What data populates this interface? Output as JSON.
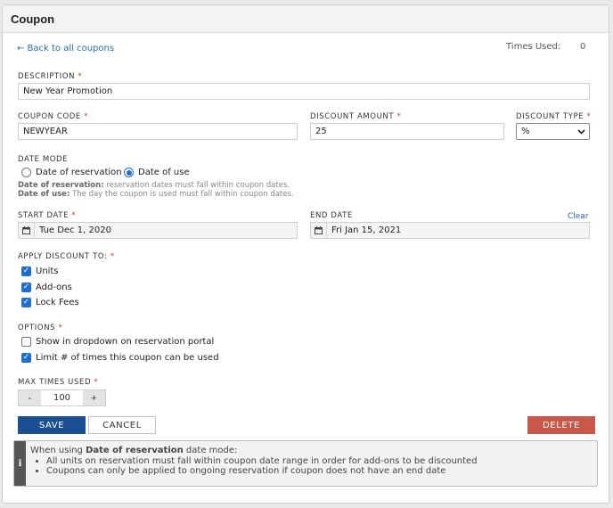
{
  "panel": {
    "title": "Coupon"
  },
  "nav": {
    "back_label": "← Back to all coupons",
    "times_used_label": "Times Used:",
    "times_used_value": "0"
  },
  "description": {
    "label": "DESCRIPTION",
    "value": "New Year Promotion"
  },
  "coupon_code": {
    "label": "COUPON CODE",
    "value": "NEWYEAR"
  },
  "discount_amount": {
    "label": "DISCOUNT AMOUNT",
    "value": "25"
  },
  "discount_type": {
    "label": "DISCOUNT TYPE",
    "value": "%"
  },
  "date_mode": {
    "label": "DATE MODE",
    "options": [
      "Date of reservation",
      "Date of use"
    ],
    "selected": "Date of use",
    "help_reservation_term": "Date of reservation:",
    "help_reservation_text": "reservation dates must fall within coupon dates.",
    "help_use_term": "Date of use:",
    "help_use_text": "The day the coupon is used must fall within coupon dates."
  },
  "start_date": {
    "label": "START DATE",
    "value": "Tue Dec 1, 2020"
  },
  "end_date": {
    "label": "END DATE",
    "value": "Fri Jan 15, 2021",
    "clear_label": "Clear"
  },
  "apply_to": {
    "label": "APPLY DISCOUNT TO:",
    "items": [
      "Units",
      "Add-ons",
      "Lock Fees"
    ]
  },
  "options": {
    "label": "OPTIONS",
    "items": [
      "Show in dropdown on reservation portal",
      "Limit # of times this coupon can be used"
    ]
  },
  "max_times": {
    "label": "MAX TIMES USED",
    "minus": "-",
    "value": "100",
    "plus": "+"
  },
  "actions": {
    "save": "SAVE",
    "cancel": "CANCEL",
    "delete": "DELETE"
  },
  "note": {
    "intro": "When using",
    "mode": "Date of reservation",
    "suffix": "date mode:",
    "bullets": [
      "All units on reservation must fall within coupon date range in order for add-ons to be discounted",
      "Coupons can only be applied to ongoing reservation if coupon does not have an end date"
    ]
  },
  "colors": {
    "primary": "#1a4f93",
    "danger": "#c9584a",
    "link": "#2a6ab0",
    "checkbox": "#1e6fd0"
  },
  "icons": [
    "calendar-icon",
    "info-icon",
    "chevron-down-icon",
    "check-icon"
  ]
}
